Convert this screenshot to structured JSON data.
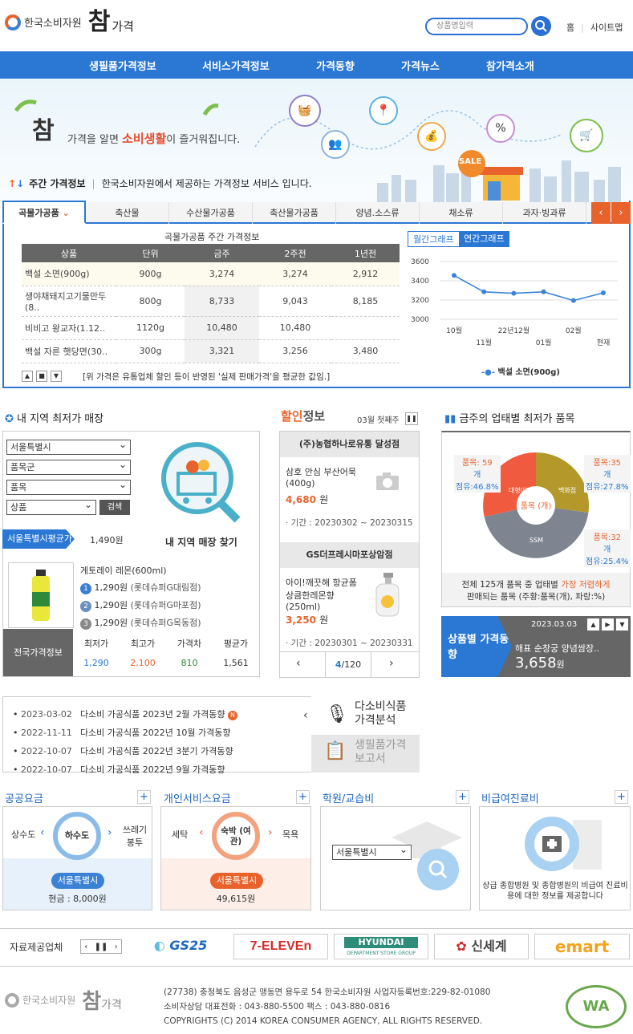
{
  "header": {
    "org_name": "한국소비자원",
    "logo_main": "참",
    "logo_sub": "가격",
    "search_placeholder": "상품명입력",
    "links": [
      "홈",
      "사이트맵"
    ]
  },
  "gnb": [
    "생필품가격정보",
    "서비스가격정보",
    "가격동향",
    "가격뉴스",
    "참가격소개"
  ],
  "banner": {
    "tagline_pre": "가격을 알면 ",
    "tagline_em": "소비생활",
    "tagline_post": "이 즐거워집니다.",
    "sale": "SALE",
    "weekly_label": "주간 가격정보",
    "weekly_desc": "한국소비자원에서 제공하는 가격정보 서비스 입니다."
  },
  "price_tabs": [
    "곡물가공품",
    "축산물",
    "수산물가공품",
    "축산물가공품",
    "양념.소스류",
    "채소류",
    "과자·빙과류"
  ],
  "price_table": {
    "title": "곡물가공품 주간 가격정보",
    "headers": [
      "상품",
      "단위",
      "금주",
      "2주전",
      "1년전"
    ],
    "rows": [
      [
        "백설 소면(900g)",
        "900g",
        "3,274",
        "3,274",
        "2,912"
      ],
      [
        "생야채돼지고기물만두(8..",
        "800g",
        "8,733",
        "9,043",
        "8,185"
      ],
      [
        "비비고 왕교자(1.12..",
        "1120g",
        "10,480",
        "10,480",
        ""
      ],
      [
        "백설 자른 햇당면(30..",
        "300g",
        "3,321",
        "3,256",
        "3,480"
      ]
    ],
    "note": "[위 가격은 유통업체 할인 등이 반영된 '실제 판매가격'을 평균한 값임.]"
  },
  "graph": {
    "tabs": [
      "월간그래프",
      "연간그래프"
    ],
    "legend": "백설 소면(900g)",
    "y_ticks": [
      "3600",
      "3400",
      "3200",
      "3000"
    ],
    "x_labels_top": [
      "10월",
      "22년12월",
      "02월"
    ],
    "x_labels_bottom": [
      "11월",
      "01월",
      "현재"
    ],
    "series_color": "#3b82d6"
  },
  "chart_data": {
    "type": "line",
    "x": [
      "10월",
      "11월",
      "22년12월",
      "01월",
      "02월",
      "현재"
    ],
    "series": [
      {
        "name": "백설 소면(900g)",
        "values": [
          3455,
          3285,
          3270,
          3285,
          3195,
          3274
        ]
      }
    ],
    "ylim": [
      3000,
      3600
    ]
  },
  "region": {
    "title": "내 지역 최저가 매장",
    "selects": [
      "서울특별시",
      "품목군",
      "품목",
      "상품"
    ],
    "search_btn": "검색",
    "find_label": "내 지역 매장 찾기",
    "avg_label": "서울특별시평균가",
    "avg_value": "1,490원",
    "product": "게토레이 레몬(600ml)",
    "ranks": [
      {
        "n": "1",
        "price": "1,290원",
        "store": "(롯데슈퍼G대림점)"
      },
      {
        "n": "2",
        "price": "1,290원",
        "store": "(롯데슈퍼G마포점)"
      },
      {
        "n": "3",
        "price": "1,290원",
        "store": "(롯데슈퍼G목동점)"
      }
    ],
    "national_label": "전국가격정보",
    "national_headers": [
      "최저가",
      "최고가",
      "가격차",
      "평균가"
    ],
    "national_values": [
      "1,290",
      "2,100",
      "810",
      "1,561"
    ]
  },
  "discount": {
    "title_a": "할인",
    "title_b": "정보",
    "week": "03월 첫째주",
    "items": [
      {
        "store": "(주)농협하나로유통 달성점",
        "name": "삼호 안심 부산어묵 (400g)",
        "price": "4,680",
        "unit": "원",
        "period": "· 기간 : 20230302 ~ 20230315"
      },
      {
        "store": "GS더프레시마포상암점",
        "name": "아이!깨끗해 항균폼 상큼한레몬향 (250ml)",
        "price": "3,250",
        "unit": "원",
        "period": "· 기간 : 20230301 ~ 20230331"
      }
    ],
    "page": "4",
    "total": "/120"
  },
  "lowest": {
    "title": "금주의 업태별 최저가 품목",
    "center": "품목 (개)",
    "segments": [
      {
        "name": "대형마트",
        "count": "품목: 59",
        "unit": "개",
        "share": "점유:46.8%",
        "color": "#f05a3e"
      },
      {
        "name": "백화점",
        "count": "품목:35",
        "unit": "개",
        "share": "점유:27.8%",
        "color": "#b5982a"
      },
      {
        "name": "SSM",
        "count": "품목:32",
        "unit": "개",
        "share": "점유:25.4%",
        "color": "#7f8590"
      }
    ],
    "desc_pre": "전체 125개 품목 중 업태별 ",
    "desc_em": "가장 저렴하게",
    "desc_post": "판매되는 품목 (주황:품목(개), 파랑:%)"
  },
  "trend": {
    "label": "상품별 가격동향",
    "date": "2023.03.03",
    "product": "해표 순창궁 양념쌈장..",
    "price": "3,658",
    "unit": "원"
  },
  "news": [
    {
      "date": "2023-03-02",
      "title": "다소비 가공식품 2023년 2월 가격동향",
      "badge": "N"
    },
    {
      "date": "2022-11-11",
      "title": "다소비 가공식품 2022년 10월 가격동향"
    },
    {
      "date": "2022-10-07",
      "title": "다소비 가공식품 2022년 3분기 가격동향"
    },
    {
      "date": "2022-10-07",
      "title": "다소비 가공식품 2022년 9월 가격동향"
    }
  ],
  "analysis": [
    "다소비식품 가격분석",
    "생필품가격 보고서"
  ],
  "services": {
    "public": {
      "title": "공공요금",
      "left": "상수도",
      "center": "하수도",
      "right": "쓰레기 봉투",
      "region": "서울특별시",
      "price": "현금 : 8,000원"
    },
    "personal": {
      "title": "개인서비스요금",
      "left": "세탁",
      "center": "숙박 (여관)",
      "right": "목욕",
      "region": "서울특별시",
      "price": "49,615원"
    },
    "academy": {
      "title": "학원/교습비",
      "select": "서울특별시"
    },
    "medical": {
      "title": "비급여진료비",
      "desc": "상급 종합병원 및 종합병원의 비급여 진료비용에 대한 정보를 제공합니다"
    }
  },
  "partners": {
    "label": "자료제공업체",
    "brands": [
      "GS25",
      "7-ELEVEn",
      "HYUNDAI",
      "신세계",
      "emart"
    ],
    "hyundai_sub": "DEPARTMENT STORE GROUP"
  },
  "footer": {
    "org": "한국소비자원",
    "lines": [
      "(27738) 충청북도 음성군 맹동면 용두로 54 한국소비자원 사업자등록번호:229-82-01080",
      "소비자상담 대표전화 : 043-880-5500 팩스 : 043-880-0816",
      "COPYRIGHTS (C) 2014 KOREA CONSUMER AGENCY, ALL RIGHTS RESERVED."
    ],
    "wa": "WA"
  }
}
